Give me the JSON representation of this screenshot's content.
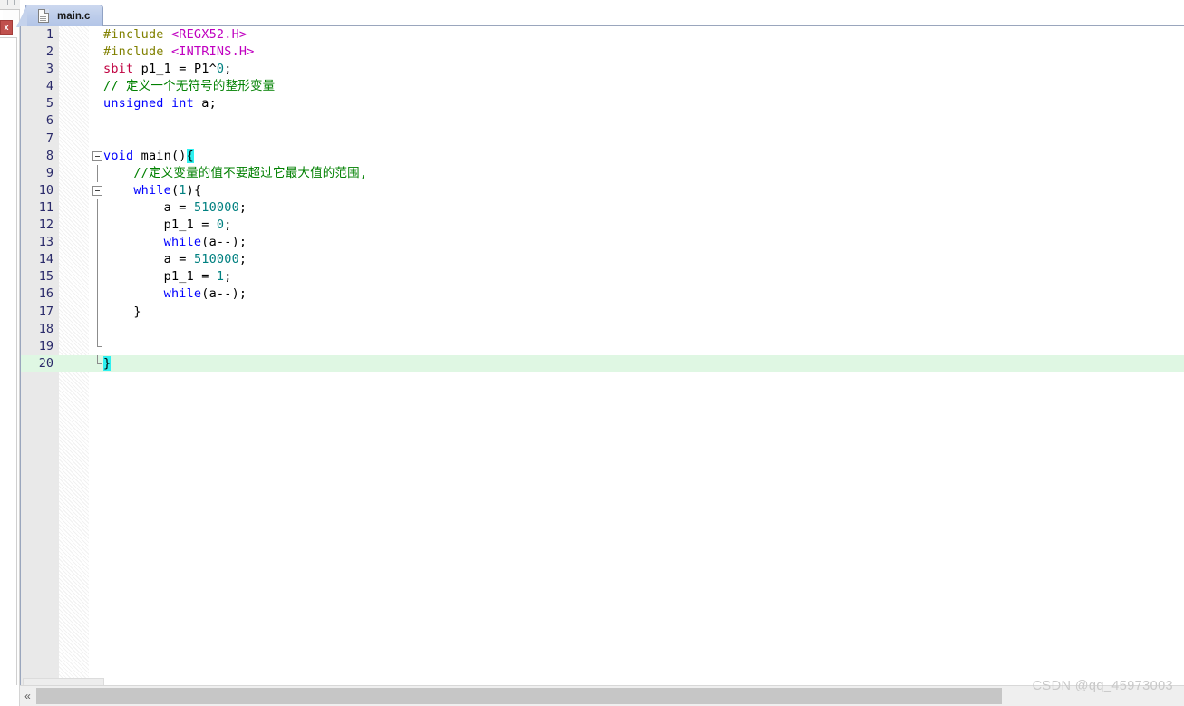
{
  "window": {
    "close_button_label": "x"
  },
  "toolbar": {
    "icons": [
      "window-icon",
      "chevron-down-icon",
      "bookmark-icon",
      "combo-icon"
    ]
  },
  "tab": {
    "label": "main.c",
    "icon": "document-icon"
  },
  "editor": {
    "current_line": 20,
    "colors": {
      "preprocessor": "#808000",
      "header": "#c000c0",
      "keyword": "#0000ff",
      "sbit": "#c00040",
      "comment": "#008000",
      "number": "#008080",
      "plain": "#000000",
      "brace_highlight_bg": "#2ef0f0",
      "current_line_bg": "#dff7e3",
      "gutter_bg": "#e9e9e9",
      "line_number": "#2a2a6a"
    },
    "lines": [
      {
        "n": "1",
        "text": "#include <REGX52.H>"
      },
      {
        "n": "2",
        "text": "#include <INTRINS.H>"
      },
      {
        "n": "3",
        "text": "sbit p1_1 = P1^0;"
      },
      {
        "n": "4",
        "text": "// 定义一个无符号的整形变量"
      },
      {
        "n": "5",
        "text": "unsigned int a;"
      },
      {
        "n": "6",
        "text": ""
      },
      {
        "n": "7",
        "text": ""
      },
      {
        "n": "8",
        "text": "void main(){"
      },
      {
        "n": "9",
        "text": "    //定义变量的值不要超过它最大值的范围,"
      },
      {
        "n": "10",
        "text": "    while(1){"
      },
      {
        "n": "11",
        "text": "        a = 510000;"
      },
      {
        "n": "12",
        "text": "        p1_1 = 0;"
      },
      {
        "n": "13",
        "text": "        while(a--);"
      },
      {
        "n": "14",
        "text": "        a = 510000;"
      },
      {
        "n": "15",
        "text": "        p1_1 = 1;"
      },
      {
        "n": "16",
        "text": "        while(a--);"
      },
      {
        "n": "17",
        "text": "    }"
      },
      {
        "n": "18",
        "text": ""
      },
      {
        "n": "19",
        "text": ""
      },
      {
        "n": "20",
        "text": "}"
      }
    ]
  },
  "scrollbar": {
    "left_arrow": "«"
  },
  "watermark": {
    "text": "CSDN @qq_45973003"
  }
}
